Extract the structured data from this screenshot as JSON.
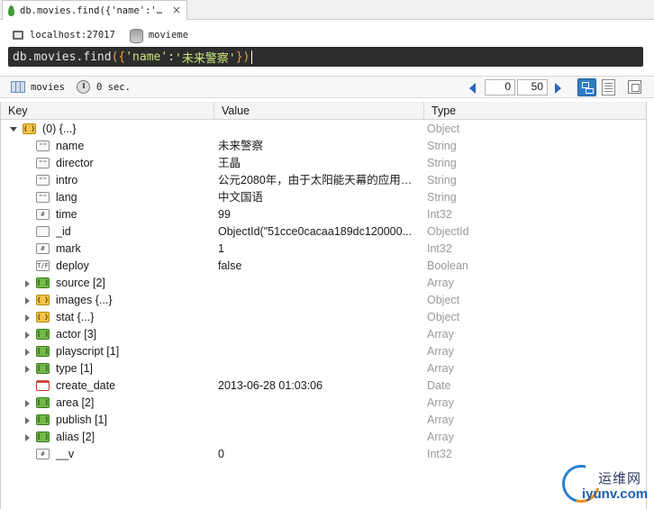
{
  "tab": {
    "title": "db.movies.find({'name':'…",
    "close": "×"
  },
  "connection": {
    "host": "localhost:27017",
    "database": "movieme"
  },
  "query": {
    "prefix": "db.movies.find",
    "open_paren": "(",
    "open_brace": "{",
    "key_str": "'name'",
    "colon": ":",
    "value_str": "'未来警察'",
    "close_brace": "}",
    "close_paren": ")"
  },
  "results_toolbar": {
    "collection": "movies",
    "time": "0 sec.",
    "skip": "0",
    "limit": "50"
  },
  "grid": {
    "headers": {
      "key": "Key",
      "value": "Value",
      "type": "Type"
    },
    "root": {
      "key": "(0)  {...}",
      "value": "",
      "type": "Object"
    },
    "rows": [
      {
        "icon": "string-icon",
        "glyph": "\"\"",
        "kind": "str",
        "expand": "none",
        "key": "name",
        "value": "未来警察",
        "type": "String"
      },
      {
        "icon": "string-icon",
        "glyph": "\"\"",
        "kind": "str",
        "expand": "none",
        "key": "director",
        "value": "王晶",
        "type": "String"
      },
      {
        "icon": "string-icon",
        "glyph": "\"\"",
        "kind": "str",
        "expand": "none",
        "key": "intro",
        "value": "公元2080年，由于太阳能天幕的应用，...",
        "type": "String"
      },
      {
        "icon": "string-icon",
        "glyph": "\"\"",
        "kind": "str",
        "expand": "none",
        "key": "lang",
        "value": "中文国语",
        "type": "String"
      },
      {
        "icon": "number-icon",
        "glyph": "#",
        "kind": "num",
        "expand": "none",
        "key": "time",
        "value": "99",
        "type": "Int32"
      },
      {
        "icon": "objectid-icon",
        "glyph": "",
        "kind": "oid",
        "expand": "none",
        "key": "_id",
        "value": "ObjectId(\"51cce0cacaa189dc120000...",
        "type": "ObjectId"
      },
      {
        "icon": "number-icon",
        "glyph": "#",
        "kind": "num",
        "expand": "none",
        "key": "mark",
        "value": "1",
        "type": "Int32"
      },
      {
        "icon": "boolean-icon",
        "glyph": "T/F",
        "kind": "bool",
        "expand": "none",
        "key": "deploy",
        "value": "false",
        "type": "Boolean"
      },
      {
        "icon": "array-icon",
        "glyph": "[ ]",
        "kind": "arr",
        "expand": "collapsed",
        "key": "source [2]",
        "value": "",
        "type": "Array"
      },
      {
        "icon": "object-icon",
        "glyph": "{ }",
        "kind": "obj",
        "expand": "collapsed",
        "key": "images  {...}",
        "value": "",
        "type": "Object"
      },
      {
        "icon": "object-icon",
        "glyph": "{ }",
        "kind": "obj",
        "expand": "collapsed",
        "key": "stat  {...}",
        "value": "",
        "type": "Object"
      },
      {
        "icon": "array-icon",
        "glyph": "[ ]",
        "kind": "arr",
        "expand": "collapsed",
        "key": "actor [3]",
        "value": "",
        "type": "Array"
      },
      {
        "icon": "array-icon",
        "glyph": "[ ]",
        "kind": "arr",
        "expand": "collapsed",
        "key": "playscript [1]",
        "value": "",
        "type": "Array"
      },
      {
        "icon": "array-icon",
        "glyph": "[ ]",
        "kind": "arr",
        "expand": "collapsed",
        "key": "type [1]",
        "value": "",
        "type": "Array"
      },
      {
        "icon": "date-icon",
        "glyph": "",
        "kind": "date",
        "expand": "none",
        "key": "create_date",
        "value": "2013-06-28 01:03:06",
        "type": "Date"
      },
      {
        "icon": "array-icon",
        "glyph": "[ ]",
        "kind": "arr",
        "expand": "collapsed",
        "key": "area [2]",
        "value": "",
        "type": "Array"
      },
      {
        "icon": "array-icon",
        "glyph": "[ ]",
        "kind": "arr",
        "expand": "collapsed",
        "key": "publish [1]",
        "value": "",
        "type": "Array"
      },
      {
        "icon": "array-icon",
        "glyph": "[ ]",
        "kind": "arr",
        "expand": "collapsed",
        "key": "alias [2]",
        "value": "",
        "type": "Array"
      },
      {
        "icon": "number-icon",
        "glyph": "#",
        "kind": "num",
        "expand": "none",
        "key": "__v",
        "value": "0",
        "type": "Int32"
      }
    ]
  },
  "watermark": {
    "cn": "运维网",
    "en": "iyunv.com"
  },
  "colors": {
    "accent": "#2f7cc7",
    "editor_bg": "#2d2d2d",
    "string_literal": "#c9e57a",
    "paren": "#e8a23b",
    "type_text": "#9a9a9a"
  }
}
